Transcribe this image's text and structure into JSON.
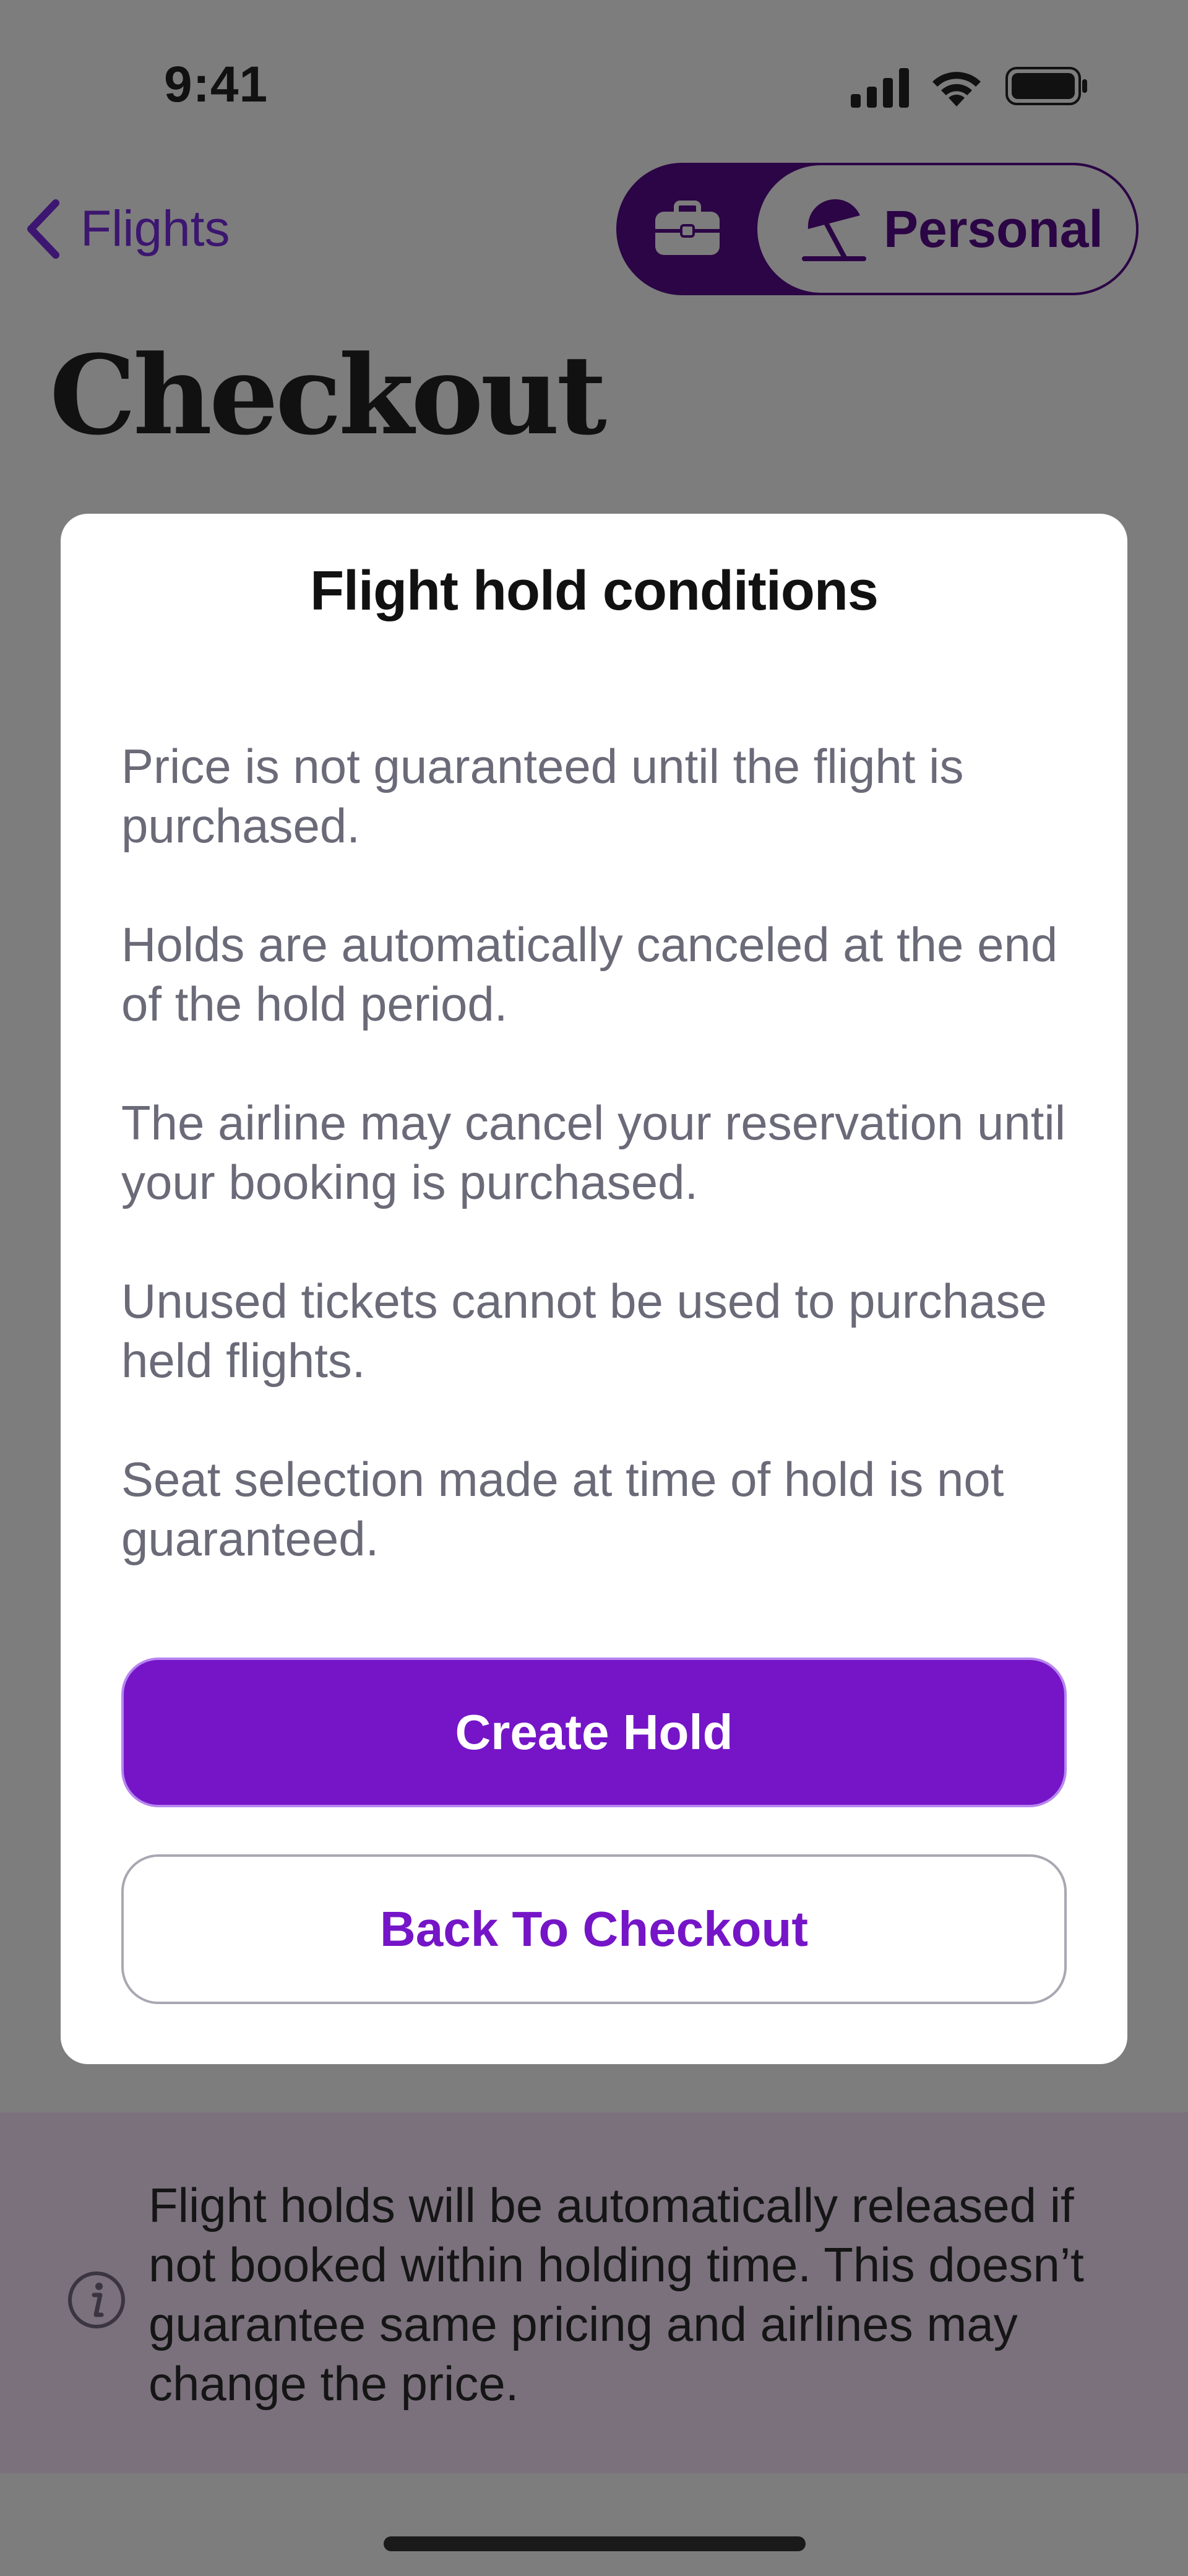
{
  "status_bar": {
    "time": "9:41"
  },
  "nav": {
    "back_label": "Flights",
    "profile_toggle": {
      "selected_label": "Personal"
    }
  },
  "page": {
    "title": "Checkout"
  },
  "modal": {
    "title": "Flight hold conditions",
    "conditions": [
      "Price is not guaranteed until the flight is purchased.",
      "Holds are automatically canceled at the end of the hold period.",
      "The airline may cancel your reservation until your booking is purchased.",
      "Unused tickets cannot be used to purchase held flights.",
      "Seat selection made at time of hold is not guaranteed."
    ],
    "primary_button": "Create Hold",
    "secondary_button": "Back To Checkout"
  },
  "info_banner": {
    "text": "Flight holds will be automatically released if not booked within holding time. This doesn’t guarantee same pricing and airlines may change the price."
  },
  "colors": {
    "brand_purple": "#7515c7",
    "dark_purple": "#2b0545",
    "overlay": "#7d7d7d"
  }
}
